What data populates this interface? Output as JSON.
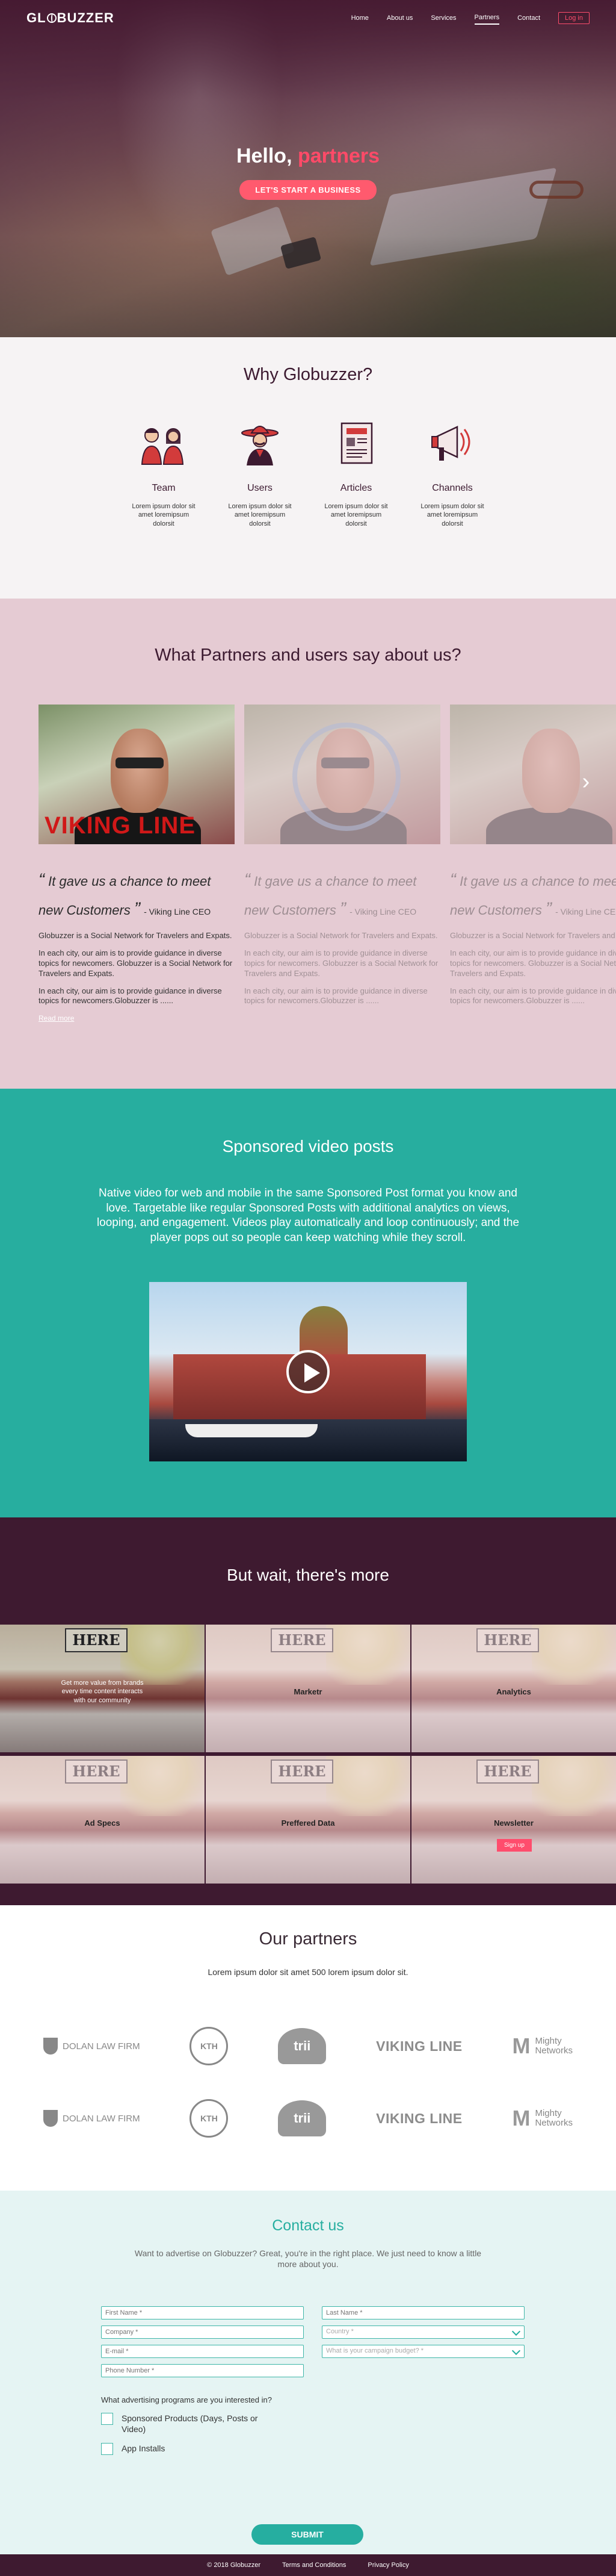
{
  "header": {
    "logo": "GL BUZZER",
    "logo_parts": [
      "GL",
      "BUZZER"
    ],
    "nav": [
      "Home",
      "About us",
      "Services",
      "Partners",
      "Contact"
    ],
    "active_nav": "Partners",
    "login_label": "Log in"
  },
  "hero": {
    "title_prefix": "Hello, ",
    "title_accent": "partners",
    "cta_label": "LET'S START A BUSINESS"
  },
  "why": {
    "title": "Why Globuzzer?",
    "features": [
      {
        "name": "Team",
        "desc": "Lorem ipsum dolor sit amet loremipsum dolorsit",
        "icon": "team-icon"
      },
      {
        "name": "Users",
        "desc": "Lorem ipsum dolor sit amet loremipsum dolorsit",
        "icon": "users-icon"
      },
      {
        "name": "Articles",
        "desc": "Lorem ipsum dolor sit amet loremipsum dolorsit",
        "icon": "articles-icon"
      },
      {
        "name": "Channels",
        "desc": "Lorem ipsum dolor sit amet loremipsum dolorsit",
        "icon": "channels-icon"
      }
    ]
  },
  "testimonials": {
    "title": "What Partners and users say about us?",
    "slides": [
      {
        "quote": "It gave us a chance to meet new Customers",
        "author": "- Viking Line CEO",
        "brand": "VIKING LINE",
        "p1": "Globuzzer is a Social Network for Travelers and Expats.",
        "p2": "In each city, our aim is to provide guidance in diverse topics for newcomers. Globuzzer is a Social Network for Travelers and Expats.",
        "p3": "In each city, our aim is to provide guidance in diverse topics for newcomers.Globuzzer is ......",
        "read_more": "Read more"
      },
      {
        "quote": "It gave us a chance to meet new Customers",
        "author": "- Viking Line CEO",
        "p1": "Globuzzer is a Social Network for Travelers and Expats.",
        "p2": "In each city, our aim is to provide guidance in diverse topics for newcomers. Globuzzer is a Social Network for Travelers and Expats.",
        "p3": "In each city, our aim is to provide guidance in diverse topics for newcomers.Globuzzer is ......"
      },
      {
        "quote": "It gave us a chance to meet new Customers",
        "author": "- Viking Line CEO",
        "p1": "Globuzzer is a Social Network for Travelers and Expats.",
        "p2": "In each city, our aim is to provide guidance in diverse topics for newcomers. Globuzzer is a Social Network for Travelers and Expats.",
        "p3": "In each city, our aim is to provide guidance in diverse topics for newcomers.Globuzzer is ......"
      }
    ],
    "next_icon": "chevron-right-icon"
  },
  "video": {
    "title": "Sponsored video posts",
    "description": "Native video for web and mobile in the same Sponsored Post format you know and love. Targetable like regular Sponsored Posts with additional analytics on views, looping, and engagement. Videos play automatically and loop continuously; and the player pops out so people can keep watching while they scroll."
  },
  "more": {
    "title": "But wait, there's more",
    "sign_text": "HERE",
    "featured_caption": "Get more value from brands every time content interacts with our community",
    "tiles": [
      "",
      "Marketr",
      "Analytics",
      "Ad Specs",
      "Preffered Data",
      "Newsletter"
    ],
    "signup_label": "Sign up"
  },
  "partners": {
    "title": "Our partners",
    "description": "Lorem ipsum dolor sit amet 500 lorem ipsum dolor sit.",
    "logos": {
      "dolan": "DOLAN LAW FIRM",
      "kth": "KTH",
      "trii": "trii",
      "viking": "VIKING LINE",
      "mighty_1": "Mighty",
      "mighty_2": "Networks"
    }
  },
  "contact": {
    "title": "Contact us",
    "description": "Want to advertise on Globuzzer? Great, you're in the right place. We just need to know a little more about you.",
    "fields": {
      "first_name": "First Name *",
      "last_name": "Last Name *",
      "company": "Company *",
      "country": "Country *",
      "email": "E-mail *",
      "budget": "What is your campaign budget? *",
      "phone": "Phone Number *"
    },
    "question": "What advertising programs are you interested in?",
    "options": [
      "Sponsored Products (Days, Posts or Video)",
      "App Installs"
    ],
    "submit_label": "SUBMIT"
  },
  "footer": {
    "copyright": "© 2018 Globuzzer",
    "links": [
      "Terms and Conditions",
      "Privacy Policy"
    ]
  },
  "colors": {
    "brand": "#3e1a30",
    "accent": "#ff4d6d",
    "teal": "#27ae9f",
    "pink_bg": "#e5cbd3"
  }
}
